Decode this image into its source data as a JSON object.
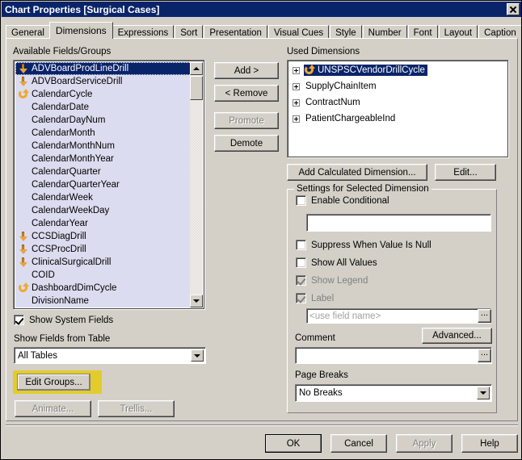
{
  "window": {
    "title": "Chart Properties [Surgical Cases]",
    "close_label": "✕"
  },
  "tabs": [
    {
      "label": "General",
      "active": false
    },
    {
      "label": "Dimensions",
      "active": true
    },
    {
      "label": "Expressions",
      "active": false
    },
    {
      "label": "Sort",
      "active": false
    },
    {
      "label": "Presentation",
      "active": false
    },
    {
      "label": "Visual Cues",
      "active": false
    },
    {
      "label": "Style",
      "active": false
    },
    {
      "label": "Number",
      "active": false
    },
    {
      "label": "Font",
      "active": false
    },
    {
      "label": "Layout",
      "active": false
    },
    {
      "label": "Caption",
      "active": false
    }
  ],
  "available_fields": {
    "label": "Available Fields/Groups",
    "items": [
      {
        "name": "ADVBoardProdLineDrill",
        "icon": "drill-icon",
        "selected": true
      },
      {
        "name": "ADVBoardServiceDrill",
        "icon": "drill-icon",
        "selected": false
      },
      {
        "name": "CalendarCycle",
        "icon": "cycle-icon",
        "selected": false
      },
      {
        "name": "CalendarDate",
        "icon": "none",
        "selected": false
      },
      {
        "name": "CalendarDayNum",
        "icon": "none",
        "selected": false
      },
      {
        "name": "CalendarMonth",
        "icon": "none",
        "selected": false
      },
      {
        "name": "CalendarMonthNum",
        "icon": "none",
        "selected": false
      },
      {
        "name": "CalendarMonthYear",
        "icon": "none",
        "selected": false
      },
      {
        "name": "CalendarQuarter",
        "icon": "none",
        "selected": false
      },
      {
        "name": "CalendarQuarterYear",
        "icon": "none",
        "selected": false
      },
      {
        "name": "CalendarWeek",
        "icon": "none",
        "selected": false
      },
      {
        "name": "CalendarWeekDay",
        "icon": "none",
        "selected": false
      },
      {
        "name": "CalendarYear",
        "icon": "none",
        "selected": false
      },
      {
        "name": "CCSDiagDrill",
        "icon": "drill-icon",
        "selected": false
      },
      {
        "name": "CCSProcDrill",
        "icon": "drill-icon",
        "selected": false
      },
      {
        "name": "ClinicalSurgicalDrill",
        "icon": "drill-icon",
        "selected": false
      },
      {
        "name": "COID",
        "icon": "none",
        "selected": false
      },
      {
        "name": "DashboardDimCycle",
        "icon": "cycle-icon",
        "selected": false
      },
      {
        "name": "DivisionName",
        "icon": "none",
        "selected": false
      }
    ]
  },
  "transfer_buttons": {
    "add": "Add >",
    "remove": "< Remove",
    "promote": "Promote",
    "promote_disabled": true,
    "demote": "Demote",
    "demote_disabled": false
  },
  "used_dimensions": {
    "label": "Used Dimensions",
    "items": [
      {
        "name": "UNSPSCVendorDrillCycle",
        "icon": "cycle-icon",
        "selected": true
      },
      {
        "name": "SupplyChainItem",
        "icon": "none",
        "selected": false
      },
      {
        "name": "ContractNum",
        "icon": "none",
        "selected": false
      },
      {
        "name": "PatientChargeableInd",
        "icon": "none",
        "selected": false
      }
    ]
  },
  "dimension_actions": {
    "add_calculated": "Add Calculated Dimension...",
    "edit": "Edit..."
  },
  "settings": {
    "title": "Settings for Selected Dimension",
    "enable_conditional": {
      "label": "Enable Conditional",
      "checked": false
    },
    "conditional_value": "",
    "suppress_when_null": {
      "label": "Suppress When Value Is Null",
      "checked": false
    },
    "show_all_values": {
      "label": "Show All Values",
      "checked": false
    },
    "show_legend": {
      "label": "Show Legend",
      "checked": true,
      "disabled": true
    },
    "label_check": {
      "label": "Label",
      "checked": true,
      "disabled": true
    },
    "label_placeholder": "<use field name>",
    "label_value": "",
    "advanced_button": "Advanced...",
    "comment_label": "Comment",
    "comment_value": "",
    "page_breaks_label": "Page Breaks",
    "page_breaks_value": "No Breaks",
    "ellipsis_label": "..."
  },
  "left_controls": {
    "show_system_fields": {
      "label": "Show System Fields",
      "checked": true
    },
    "show_fields_from_table_label": "Show Fields from Table",
    "table_filter_value": "All Tables",
    "edit_groups": "Edit Groups...",
    "animate": "Animate...",
    "trellis": "Trellis..."
  },
  "footer": {
    "ok": "OK",
    "cancel": "Cancel",
    "apply": "Apply",
    "apply_disabled": true,
    "help": "Help"
  },
  "colors": {
    "titlebar": "#0a246a",
    "dialog_face": "#d4d0c8",
    "selection": "#0a246a",
    "list_background": "#dcdcf0",
    "highlight_annotation": "#e3cc2a",
    "icon_orange": "#f0a830"
  }
}
